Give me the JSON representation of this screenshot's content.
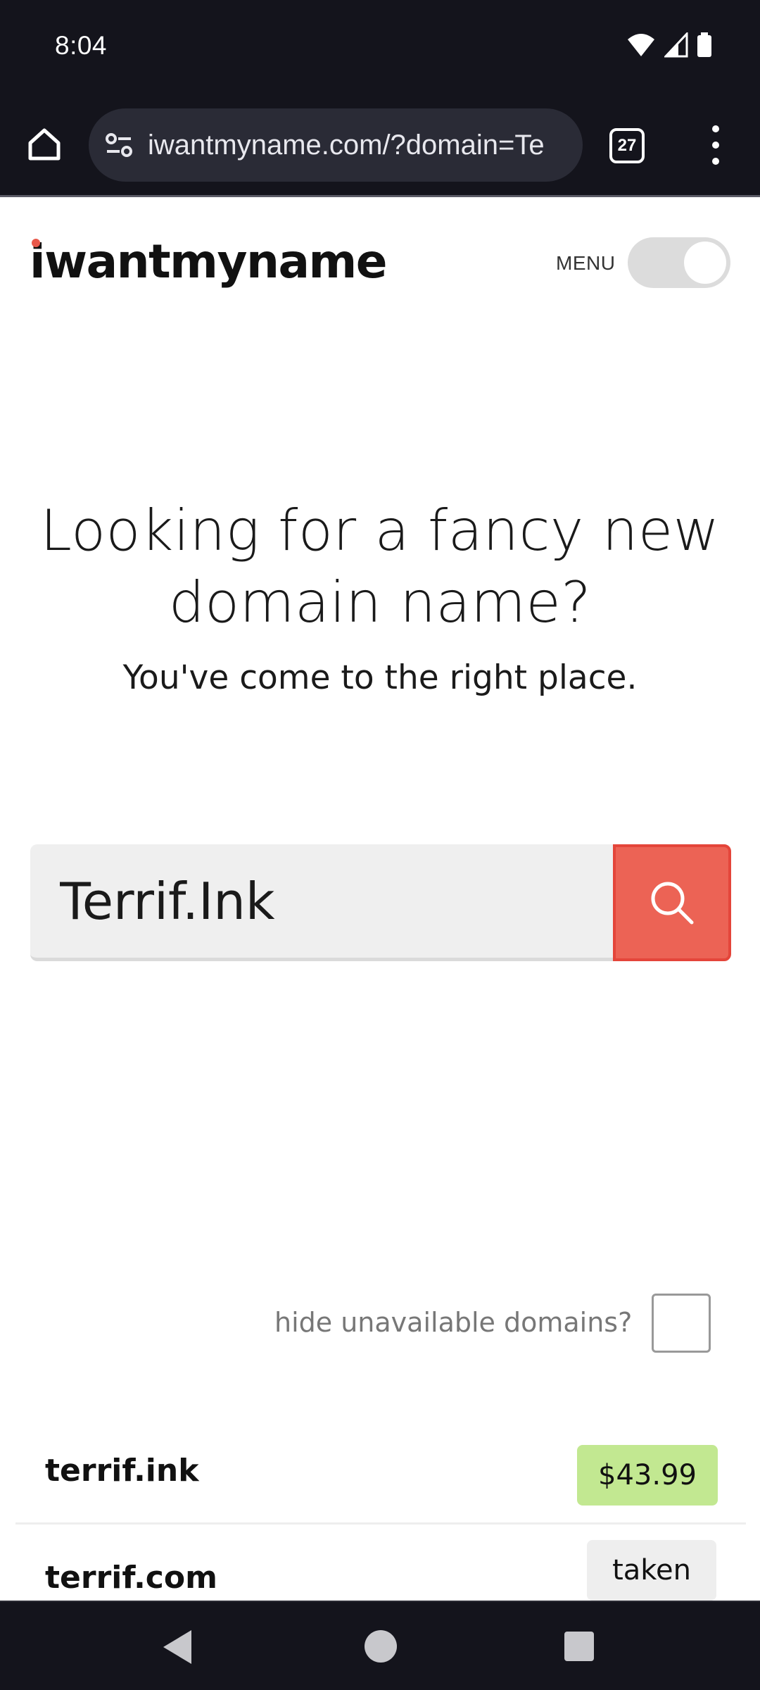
{
  "status": {
    "time": "8:04"
  },
  "browser": {
    "url": "iwantmyname.com/?domain=Te",
    "tab_count": "27"
  },
  "header": {
    "logo": "iwantmyname",
    "menu_label": "MENU"
  },
  "hero": {
    "headline": "Looking for a fancy new domain name?",
    "subhead": "You've come to the right place."
  },
  "search": {
    "value": "Terrif.Ink"
  },
  "filter": {
    "hide_unavailable_label": "hide unavailable domains?",
    "checked": false
  },
  "results": [
    {
      "domain": "terrif.ink",
      "status": "$43.99"
    },
    {
      "domain": "terrif.com",
      "status": "taken"
    }
  ],
  "colors": {
    "accent": "#ec6355",
    "available": "#c2e891",
    "taken": "#eeeeee",
    "chrome": "#14141c"
  }
}
